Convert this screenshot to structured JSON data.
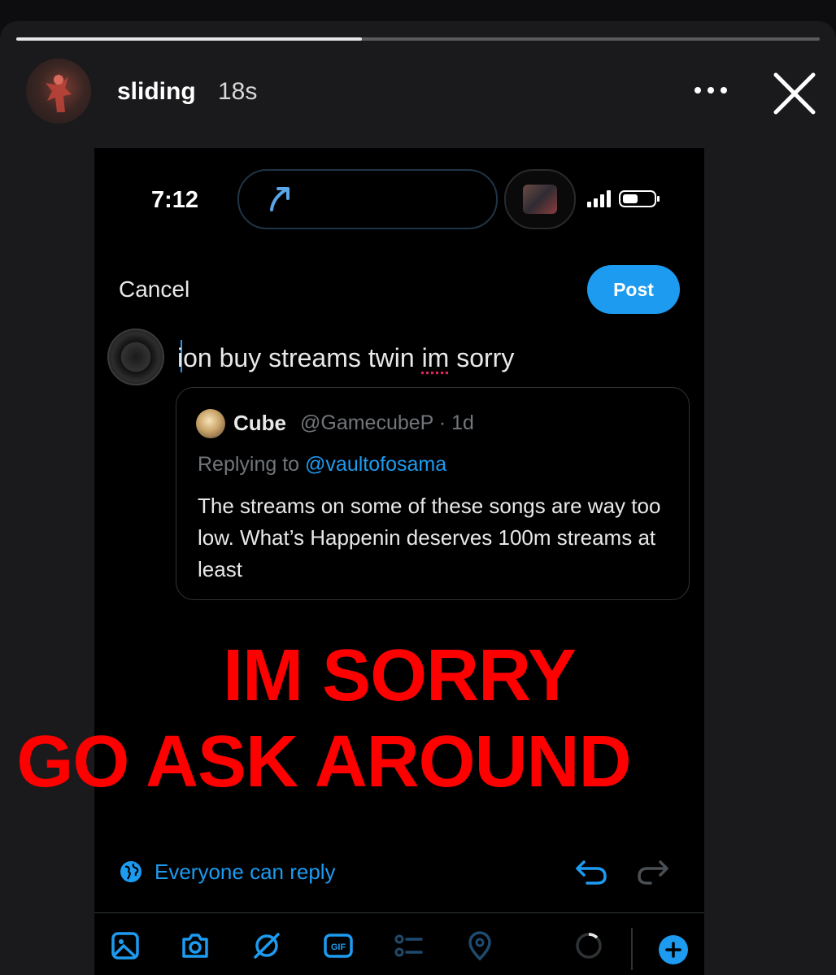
{
  "story": {
    "username": "sliding",
    "time_ago": "18s",
    "progress": 0.43
  },
  "phone": {
    "clock": "7:12"
  },
  "composer": {
    "cancel_label": "Cancel",
    "post_label": "Post",
    "text_before": "ion buy streams twin ",
    "text_misspelled": "im",
    "text_after": " sorry"
  },
  "quoted_tweet": {
    "name": "Cube",
    "handle_meta": "@GamecubeP · 1d",
    "replying_prefix": "Replying to ",
    "replying_handle": "@vaultofosama",
    "body": "The streams on some of these songs are way too low. What’s Happenin deserves 100m streams at least"
  },
  "overlay": {
    "line1": "IM SORRY",
    "line2": "GO ASK AROUND",
    "color": "#ff0000"
  },
  "reply_setting": {
    "label": "Everyone can reply"
  },
  "colors": {
    "accent": "#1d9bf0",
    "background": "#000000"
  },
  "toolbar": {
    "icons": [
      "image-icon",
      "camera-icon",
      "grok-icon",
      "gif-icon",
      "poll-icon",
      "location-icon",
      "character-count-icon",
      "add-post-icon"
    ]
  }
}
